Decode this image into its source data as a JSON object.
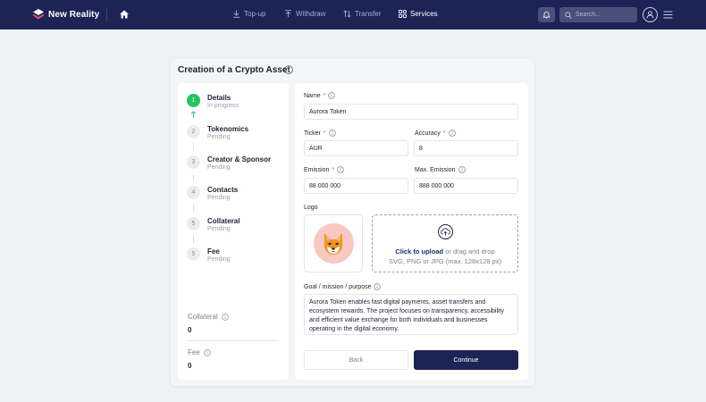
{
  "header": {
    "brand": "New Reality",
    "home_icon": "home-icon",
    "nav": [
      {
        "label": "Top-up",
        "icon": "arrow-down-to-line-icon",
        "active": false
      },
      {
        "label": "Withdraw",
        "icon": "arrow-up-from-line-icon",
        "active": false
      },
      {
        "label": "Transfer",
        "icon": "arrows-up-down-icon",
        "active": false
      },
      {
        "label": "Services",
        "icon": "grid-icon",
        "active": true
      }
    ],
    "search_placeholder": "Search..."
  },
  "page": {
    "title": "Creation of a Crypto Asset"
  },
  "steps": [
    {
      "num": "1",
      "title": "Details",
      "status": "In progress",
      "current": true
    },
    {
      "num": "2",
      "title": "Tokenomics",
      "status": "Pending",
      "current": false
    },
    {
      "num": "3",
      "title": "Creator & Sponsor",
      "status": "Pending",
      "current": false
    },
    {
      "num": "4",
      "title": "Contacts",
      "status": "Pending",
      "current": false
    },
    {
      "num": "5",
      "title": "Collateral",
      "status": "Pending",
      "current": false
    },
    {
      "num": "5",
      "title": "Fee",
      "status": "Pending",
      "current": false
    }
  ],
  "summary": {
    "collateral_label": "Collateral",
    "collateral_value": "0",
    "fee_label": "Fee",
    "fee_value": "0"
  },
  "form": {
    "name_label": "Name",
    "name_value": "Aurora Token",
    "ticker_label": "Ticker",
    "ticker_value": "AUR",
    "accuracy_label": "Accuracy",
    "accuracy_value": "8",
    "emission_label": "Emission",
    "emission_value": "88 000 000",
    "max_emission_label": "Max. Emission",
    "max_emission_value": "888 000 000",
    "logo_label": "Logo",
    "upload_link": "Click to upload",
    "upload_rest": " or drag and drop",
    "upload_hint": "SVG, PNG or JPG (max. 128x128 px)",
    "goal_label": "Goal / mission / purpose",
    "goal_value": "Aurora Token enables fast digital payments, asset transfers and ecosystem rewards. The project focuses on transparency, accessibility and efficient value exchange for both individuals and businesses operating in the digital economy.",
    "back_label": "Back",
    "continue_label": "Continue",
    "required_mark": "*"
  },
  "colors": {
    "header_bg": "#1c2456",
    "accent": "#1c2456",
    "step_active": "#22c55e"
  }
}
